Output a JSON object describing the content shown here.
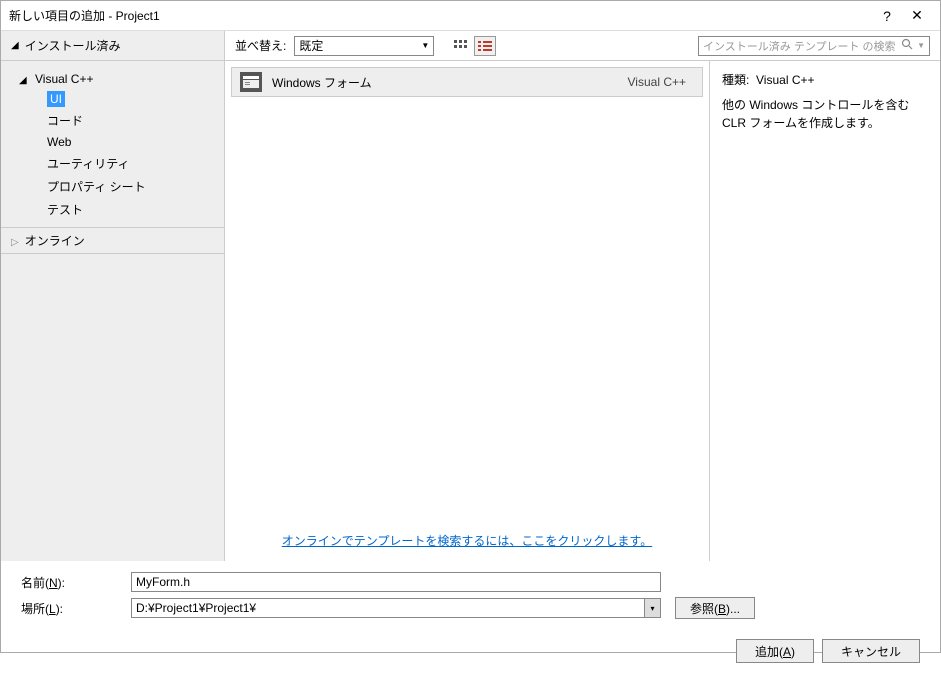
{
  "titlebar": {
    "title": "新しい項目の追加 - Project1",
    "help": "?",
    "close": "✕"
  },
  "toolbar": {
    "installed_tab": "インストール済み",
    "sort_label": "並べ替え:",
    "sort_value": "既定",
    "search_placeholder": "インストール済み テンプレート の検索 (Ctrl+E"
  },
  "sidebar": {
    "visual_cpp": "Visual C++",
    "items": [
      "UI",
      "コード",
      "Web",
      "ユーティリティ",
      "プロパティ シート",
      "テスト"
    ],
    "selected_index": 0,
    "online": "オンライン"
  },
  "center": {
    "item_name": "Windows フォーム",
    "item_lang": "Visual C++",
    "online_search_link": "オンラインでテンプレートを検索するには、ここをクリックします。"
  },
  "details": {
    "type_label": "種類:",
    "type_value": "Visual C++",
    "description": "他の Windows コントロールを含む CLR フォームを作成します。"
  },
  "form": {
    "name_label": "名前(N):",
    "name_value": "MyForm.h",
    "location_label": "場所(L):",
    "location_value": "D:¥Project1¥Project1¥",
    "browse_label": "参照(B)..."
  },
  "footer": {
    "add": "追加(A)",
    "cancel": "キャンセル"
  }
}
